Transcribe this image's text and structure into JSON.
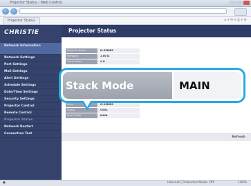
{
  "sidebar": {
    "logo": "CHRISTIE",
    "items": [
      {
        "label": "Network Information",
        "selected": true
      },
      {
        "label": "Network Settings"
      },
      {
        "label": "Port Settings"
      },
      {
        "label": "Mail Settings"
      },
      {
        "label": "Alert Settings"
      },
      {
        "label": "Schedule Settings"
      },
      {
        "label": "Date/Time Settings"
      },
      {
        "label": "Security Settings"
      },
      {
        "label": "Projector Control"
      },
      {
        "label": "Remote Control"
      },
      {
        "label": "Projector Status",
        "dim": true
      },
      {
        "label": "Network Restart"
      },
      {
        "label": "Connection Test"
      }
    ]
  },
  "main": {
    "title": "Projector Status",
    "rows_top": [
      {
        "k": "Projector Name",
        "v": "M-SERIES"
      },
      {
        "k": "Firmware",
        "v": "1.00 IL"
      },
      {
        "k": "Lamp Hours",
        "v": "0 H"
      }
    ],
    "rows_bottom": [
      {
        "k": "Input",
        "v": "M-SERIES"
      },
      {
        "k": "Status",
        "v": "COOL"
      },
      {
        "k": "Stack Mode",
        "v": "MAIN"
      }
    ],
    "refresh_label": "Refresh"
  },
  "callout": {
    "label": "Stack Mode",
    "value": "MAIN",
    "accent": "#27a9e1"
  },
  "browser": {
    "window_title": "Projector Status - Web Control",
    "tab_label": "Projector Status",
    "status_zone": "Internet | Protected Mode: Off",
    "zoom": "100%"
  }
}
